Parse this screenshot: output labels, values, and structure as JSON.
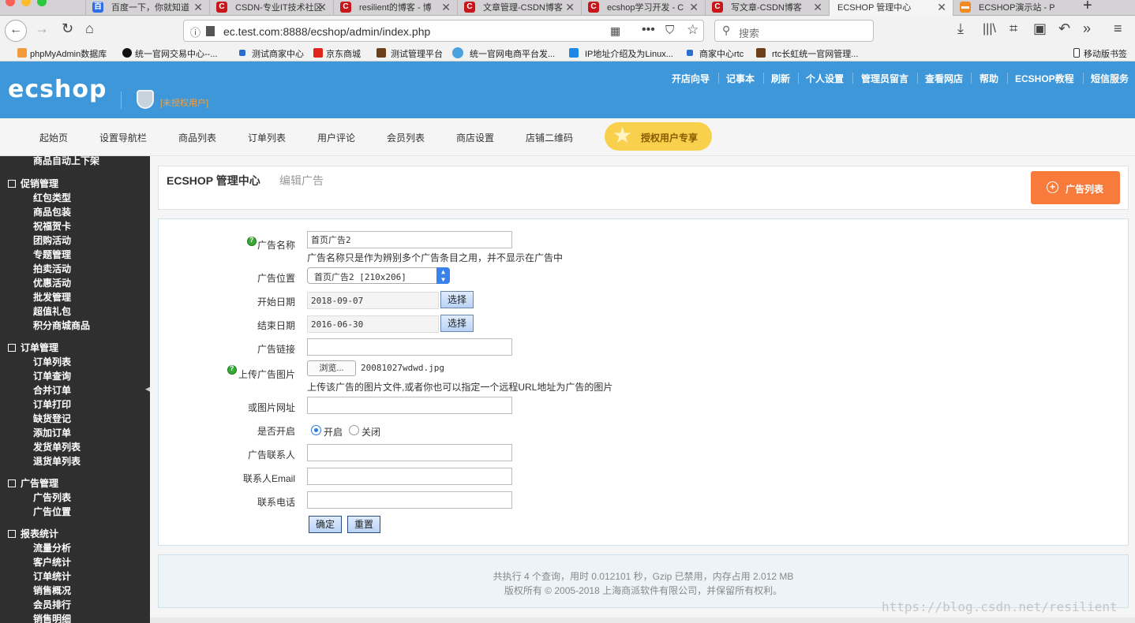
{
  "browser": {
    "tabs": [
      {
        "title": "百度一下，你就知道",
        "icon": "baidu-icon",
        "color": "#2e6ce6"
      },
      {
        "title": "CSDN-专业IT技术社区",
        "icon": "csdn-icon",
        "color": "#c8161d"
      },
      {
        "title": "resilient的博客 - 博",
        "icon": "csdn-icon",
        "color": "#c8161d"
      },
      {
        "title": "文章管理-CSDN博客",
        "icon": "csdn-icon",
        "color": "#c8161d"
      },
      {
        "title": "ecshop学习开发 - C",
        "icon": "csdn-icon",
        "color": "#c8161d"
      },
      {
        "title": "写文章-CSDN博客",
        "icon": "csdn-icon",
        "color": "#c8161d"
      },
      {
        "title": "ECSHOP 管理中心",
        "icon": "",
        "color": "#f5f5f5",
        "active": true
      },
      {
        "title": "ECSHOP演示站 - P",
        "icon": "cart-icon",
        "color": "#f08a24"
      }
    ],
    "url": "ec.test.com:8888/ecshop/admin/index.php",
    "search_placeholder": "搜索",
    "bookmarks": [
      "phpMyAdmin数据库",
      "统一官网交易中心--...",
      "测试商家中心",
      "京东商城",
      "测试管理平台",
      "统一官网电商平台发...",
      "IP地址介绍及为Linux...",
      "商家中心rtc",
      "rtc长虹统一官网管理...",
      "移动版书签"
    ]
  },
  "header": {
    "logo": "ecshop",
    "unauthorized": "[未授权用户]",
    "links": [
      "开店向导",
      "记事本",
      "刷新",
      "个人设置",
      "管理员留言",
      "查看网店",
      "帮助",
      "ECSHOP教程",
      "短信服务"
    ]
  },
  "menu": {
    "items": [
      "起始页",
      "设置导航栏",
      "商品列表",
      "订单列表",
      "用户评论",
      "会员列表",
      "商店设置",
      "店铺二维码"
    ],
    "vip": "授权用户专享"
  },
  "sidebar": {
    "top_item": "商品自动上下架",
    "groups": [
      {
        "title": "促销管理",
        "items": [
          "红包类型",
          "商品包装",
          "祝福贺卡",
          "团购活动",
          "专题管理",
          "拍卖活动",
          "优惠活动",
          "批发管理",
          "超值礼包",
          "积分商城商品"
        ]
      },
      {
        "title": "订单管理",
        "items": [
          "订单列表",
          "订单查询",
          "合并订单",
          "订单打印",
          "缺货登记",
          "添加订单",
          "发货单列表",
          "退货单列表"
        ]
      },
      {
        "title": "广告管理",
        "items": [
          "广告列表",
          "广告位置"
        ]
      },
      {
        "title": "报表统计",
        "items": [
          "流量分析",
          "客户统计",
          "订单统计",
          "销售概况",
          "会员排行",
          "销售明细"
        ]
      }
    ]
  },
  "page": {
    "title": "ECSHOP 管理中心",
    "subtitle": "编辑广告",
    "ad_list_button": "广告列表"
  },
  "form": {
    "ad_name_label": "广告名称",
    "ad_name_value": "首页广告2",
    "ad_name_hint": "广告名称只是作为辨别多个广告条目之用，并不显示在广告中",
    "position_label": "广告位置",
    "position_value": "首页广告2 [210x206]",
    "start_label": "开始日期",
    "start_value": "2018-09-07",
    "end_label": "结束日期",
    "end_value": "2016-06-30",
    "select_label": "选择",
    "link_label": "广告链接",
    "link_value": "",
    "upload_label": "上传广告图片",
    "browse_label": "浏览...",
    "file_name": "20081027wdwd.jpg",
    "upload_hint": "上传该广告的图片文件,或者你也可以指定一个远程URL地址为广告的图片",
    "img_url_label": "或图片网址",
    "enabled_label": "是否开启",
    "enabled_on": "开启",
    "enabled_off": "关闭",
    "contact_label": "广告联系人",
    "email_label": "联系人Email",
    "phone_label": "联系电话",
    "submit_label": "确定",
    "reset_label": "重置"
  },
  "footer": {
    "line1": "共执行 4 个查询，用时 0.012101 秒，Gzip 已禁用，内存占用 2.012 MB",
    "line2": "版权所有 © 2005-2018 上海商派软件有限公司，并保留所有权利。"
  },
  "watermark": "https://blog.csdn.net/resilient"
}
